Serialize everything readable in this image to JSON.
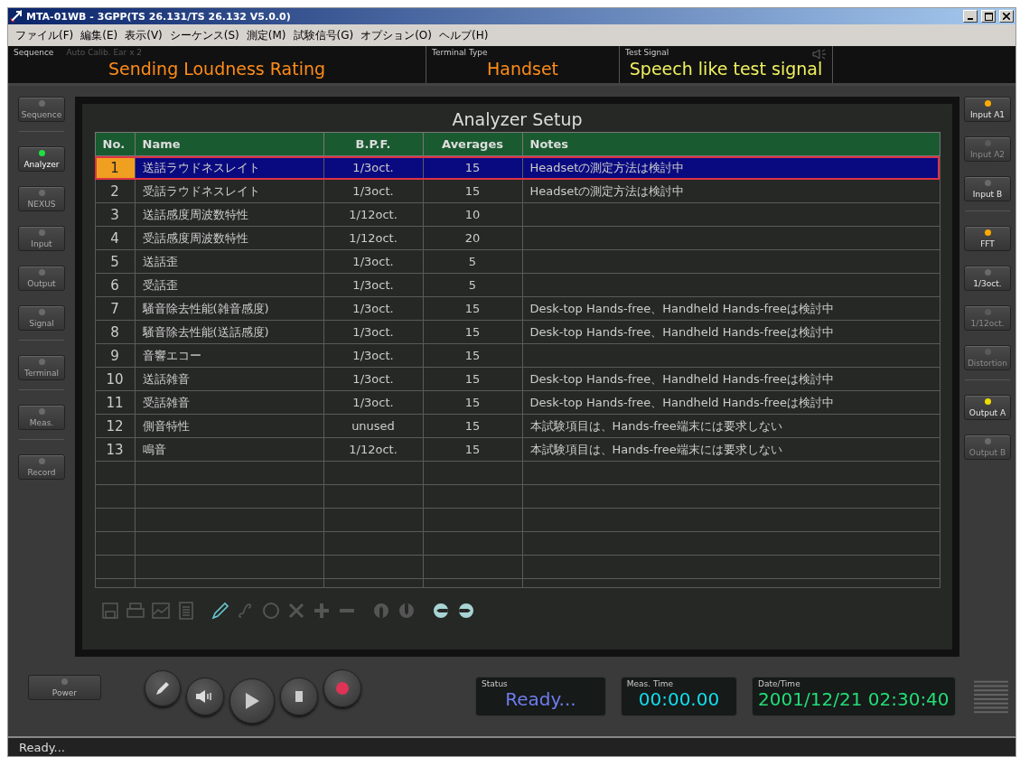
{
  "window": {
    "title": "MTA-01WB - 3GPP(TS 26.131/TS 26.132 V5.0.0)"
  },
  "menu": [
    "ファイル(F)",
    "編集(E)",
    "表示(V)",
    "シーケンス(S)",
    "測定(M)",
    "試験信号(G)",
    "オプション(O)",
    "ヘルプ(H)"
  ],
  "info": {
    "sequence": {
      "label": "Sequence",
      "hint": "Auto Calib.  Ear x 2",
      "value": "Sending Loudness Rating"
    },
    "terminal_type": {
      "label": "Terminal Type",
      "value": "Handset"
    },
    "test_signal": {
      "label": "Test Signal",
      "value": "Speech like test signal"
    }
  },
  "left_nav": [
    [
      {
        "label": "Sequence",
        "selected": false,
        "color": "#6a6a6a"
      }
    ],
    [
      {
        "label": "Analyzer",
        "selected": true,
        "color": "#22dd44"
      },
      {
        "label": "NEXUS",
        "selected": false,
        "color": "#6a6a6a"
      },
      {
        "label": "Input",
        "selected": false,
        "color": "#6a6a6a"
      },
      {
        "label": "Output",
        "selected": false,
        "color": "#6a6a6a"
      },
      {
        "label": "Signal",
        "selected": false,
        "color": "#6a6a6a"
      }
    ],
    [
      {
        "label": "Terminal",
        "selected": false,
        "color": "#6a6a6a"
      }
    ],
    [
      {
        "label": "Meas.",
        "selected": false,
        "color": "#6a6a6a"
      }
    ],
    [
      {
        "label": "Record",
        "selected": false,
        "color": "#6a6a6a"
      }
    ]
  ],
  "right_nav": [
    [
      {
        "label": "Input A1",
        "disabled": false,
        "color": "#ffaa00"
      },
      {
        "label": "Input A2",
        "disabled": true,
        "color": "#5a5a5a"
      },
      {
        "label": "Input B",
        "disabled": false,
        "color": "#6a6a6a"
      }
    ],
    [
      {
        "label": "FFT",
        "disabled": false,
        "color": "#ffaa00"
      },
      {
        "label": "1/3oct.",
        "disabled": false,
        "color": "#6a6a6a"
      },
      {
        "label": "1/12oct.",
        "disabled": true,
        "color": "#5a5a5a"
      },
      {
        "label": "Distortion",
        "disabled": true,
        "color": "#5a5a5a"
      }
    ],
    [
      {
        "label": "Output A",
        "disabled": false,
        "color": "#eedd00"
      },
      {
        "label": "Output B",
        "disabled": true,
        "color": "#6a6a6a"
      }
    ]
  ],
  "panel": {
    "title": "Analyzer Setup",
    "columns": [
      "No.",
      "Name",
      "B.P.F.",
      "Averages",
      "Notes"
    ],
    "rows": [
      {
        "no": "1",
        "name": "送話ラウドネスレイト",
        "bpf": "1/3oct.",
        "averages": "15",
        "notes": "Headsetの測定方法は検討中",
        "selected": true
      },
      {
        "no": "2",
        "name": "受話ラウドネスレイト",
        "bpf": "1/3oct.",
        "averages": "15",
        "notes": "Headsetの測定方法は検討中",
        "selected": false
      },
      {
        "no": "3",
        "name": "送話感度周波数特性",
        "bpf": "1/12oct.",
        "averages": "10",
        "notes": "",
        "selected": false
      },
      {
        "no": "4",
        "name": "受話感度周波数特性",
        "bpf": "1/12oct.",
        "averages": "20",
        "notes": "",
        "selected": false
      },
      {
        "no": "5",
        "name": "送話歪",
        "bpf": "1/3oct.",
        "averages": "5",
        "notes": "",
        "selected": false
      },
      {
        "no": "6",
        "name": "受話歪",
        "bpf": "1/3oct.",
        "averages": "5",
        "notes": "",
        "selected": false
      },
      {
        "no": "7",
        "name": "騒音除去性能(雑音感度)",
        "bpf": "1/3oct.",
        "averages": "15",
        "notes": "Desk-top Hands-free、Handheld Hands-freeは検討中",
        "selected": false
      },
      {
        "no": "8",
        "name": "騒音除去性能(送話感度)",
        "bpf": "1/3oct.",
        "averages": "15",
        "notes": "Desk-top Hands-free、Handheld Hands-freeは検討中",
        "selected": false
      },
      {
        "no": "9",
        "name": "音響エコー",
        "bpf": "1/3oct.",
        "averages": "15",
        "notes": "",
        "selected": false
      },
      {
        "no": "10",
        "name": "送話雑音",
        "bpf": "1/3oct.",
        "averages": "15",
        "notes": "Desk-top Hands-free、Handheld Hands-freeは検討中",
        "selected": false
      },
      {
        "no": "11",
        "name": "受話雑音",
        "bpf": "1/3oct.",
        "averages": "15",
        "notes": "Desk-top Hands-free、Handheld Hands-freeは検討中",
        "selected": false
      },
      {
        "no": "12",
        "name": "側音特性",
        "bpf": "unused",
        "averages": "15",
        "notes": "本試験項目は、Hands-free端末には要求しない",
        "selected": false
      },
      {
        "no": "13",
        "name": "鳴音",
        "bpf": "1/12oct.",
        "averages": "15",
        "notes": "本試験項目は、Hands-free端末には要求しない",
        "selected": false
      }
    ],
    "tools": [
      {
        "kind": "save",
        "disabled": true
      },
      {
        "kind": "print",
        "disabled": true
      },
      {
        "kind": "graph",
        "disabled": true
      },
      {
        "kind": "list",
        "disabled": true
      },
      {
        "kind": "pencil",
        "disabled": false
      },
      {
        "kind": "curve",
        "disabled": true
      },
      {
        "kind": "circle",
        "disabled": true
      },
      {
        "kind": "cross",
        "disabled": true
      },
      {
        "kind": "plus",
        "disabled": true
      },
      {
        "kind": "minus",
        "disabled": true
      },
      {
        "kind": "up",
        "disabled": true
      },
      {
        "kind": "down",
        "disabled": true
      },
      {
        "kind": "left",
        "disabled": false
      },
      {
        "kind": "right",
        "disabled": false
      }
    ]
  },
  "power": {
    "label": "Power",
    "color": "#6a6a6a"
  },
  "displays": [
    {
      "label": "Status",
      "value": "Ready...",
      "color": "#6f7cf0"
    },
    {
      "label": "Meas. Time",
      "value": "00:00.00",
      "color": "#11ddee"
    },
    {
      "label": "Date/Time",
      "value": "2001/12/21 02:30:40",
      "color": "#22dd77"
    }
  ],
  "status_bar": "Ready..."
}
